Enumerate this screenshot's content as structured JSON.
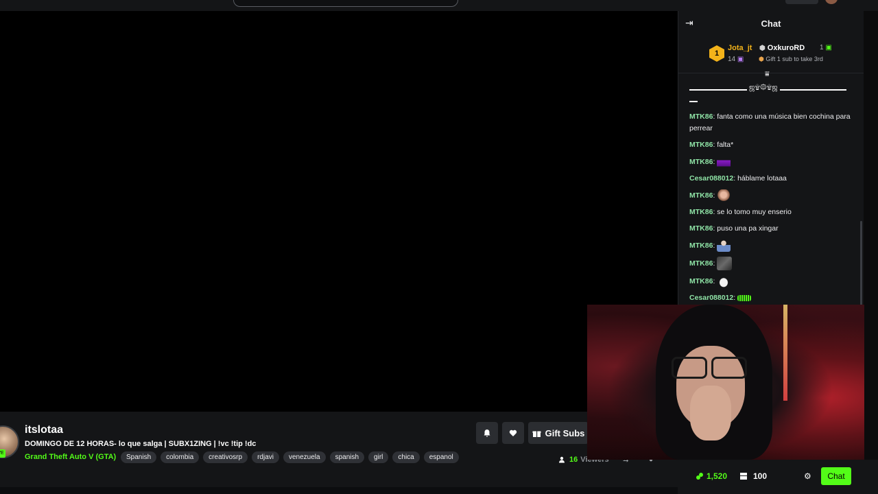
{
  "app": {
    "accent": "#53fc18",
    "background": "#0b0b0c",
    "panel": "#141517"
  },
  "stream": {
    "streamer_name": "itslotaa",
    "title": "DOMINGO DE 12 HORAS- lo que salga | SUBX1ZING | !vc !tip !dc",
    "category": "Grand Theft Auto V (GTA)",
    "tags": [
      "Spanish",
      "colombia",
      "creativosrp",
      "rdjavi",
      "venezuela",
      "spanish",
      "girl",
      "chica",
      "espanol"
    ],
    "live_label": "VE",
    "viewer_count": "16",
    "viewer_label": "Viewers",
    "gift_label": "Gift Subs"
  },
  "chat": {
    "title": "Chat",
    "leaderboard": {
      "first": {
        "rank": "1",
        "name": "Jota_jt",
        "count": "14"
      },
      "second": {
        "name": "OxkuroRD",
        "count": "1"
      },
      "gift_prompt": "Gift 1 sub to take 3rd"
    },
    "decoration": "ஜ۩۞۩ஜ",
    "messages": [
      {
        "user": "MTK86",
        "text": "fanta como una música bien cochina para perrear"
      },
      {
        "user": "MTK86",
        "text": "falta*"
      },
      {
        "user": "MTK86",
        "text": "",
        "emote": "car-emote"
      },
      {
        "user": "Cesar088012",
        "text": "háblame lotaaa"
      },
      {
        "user": "MTK86",
        "text": "",
        "emote": "face-emote"
      },
      {
        "user": "MTK86",
        "text": "se lo tomo muy enserio"
      },
      {
        "user": "MTK86",
        "text": "puso una pa xingar"
      },
      {
        "user": "MTK86",
        "text": "",
        "emote": "person-emote"
      },
      {
        "user": "MTK86",
        "text": "",
        "emote": "photo-emote"
      },
      {
        "user": "MTK86",
        "text": "",
        "emote": "goose-emote"
      },
      {
        "user": "Cesar088012",
        "text": "",
        "emote": "green-emote"
      }
    ],
    "points": "1,520",
    "storage": "100",
    "chat_button": "Chat"
  }
}
